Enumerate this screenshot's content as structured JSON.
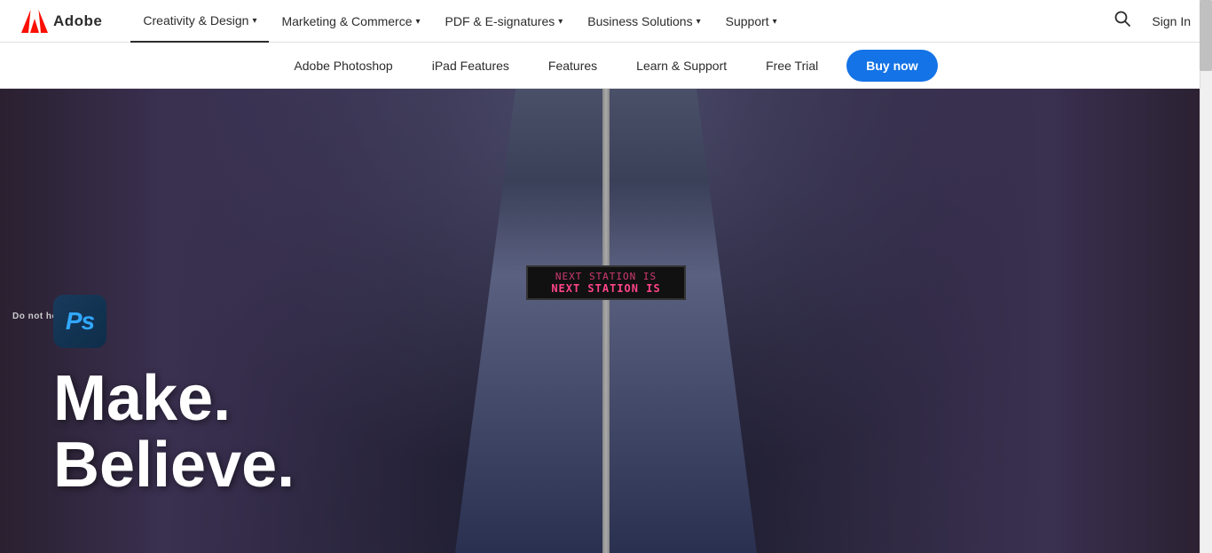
{
  "brand": {
    "logo_text": "Adobe",
    "logo_aria": "Adobe logo"
  },
  "top_nav": {
    "items": [
      {
        "id": "creativity",
        "label": "Creativity & Design",
        "has_chevron": true,
        "active": true
      },
      {
        "id": "marketing",
        "label": "Marketing & Commerce",
        "has_chevron": true,
        "active": false
      },
      {
        "id": "pdf",
        "label": "PDF & E-signatures",
        "has_chevron": true,
        "active": false
      },
      {
        "id": "business",
        "label": "Business Solutions",
        "has_chevron": true,
        "active": false
      },
      {
        "id": "support",
        "label": "Support",
        "has_chevron": true,
        "active": false
      }
    ],
    "search_aria": "Search",
    "sign_in_label": "Sign In"
  },
  "secondary_nav": {
    "items": [
      {
        "id": "photoshop",
        "label": "Adobe Photoshop"
      },
      {
        "id": "ipad",
        "label": "iPad Features"
      },
      {
        "id": "features",
        "label": "Features"
      },
      {
        "id": "learn",
        "label": "Learn & Support"
      },
      {
        "id": "trial",
        "label": "Free Trial"
      }
    ],
    "cta_label": "Buy now"
  },
  "hero": {
    "ps_icon_text": "Ps",
    "headline_line1": "Make.",
    "headline_line2": "Believe.",
    "led_line1": "NEXT STATION IS",
    "led_line2": "NEXT STATION IS",
    "do_not_sign": "Do not hold doors"
  }
}
